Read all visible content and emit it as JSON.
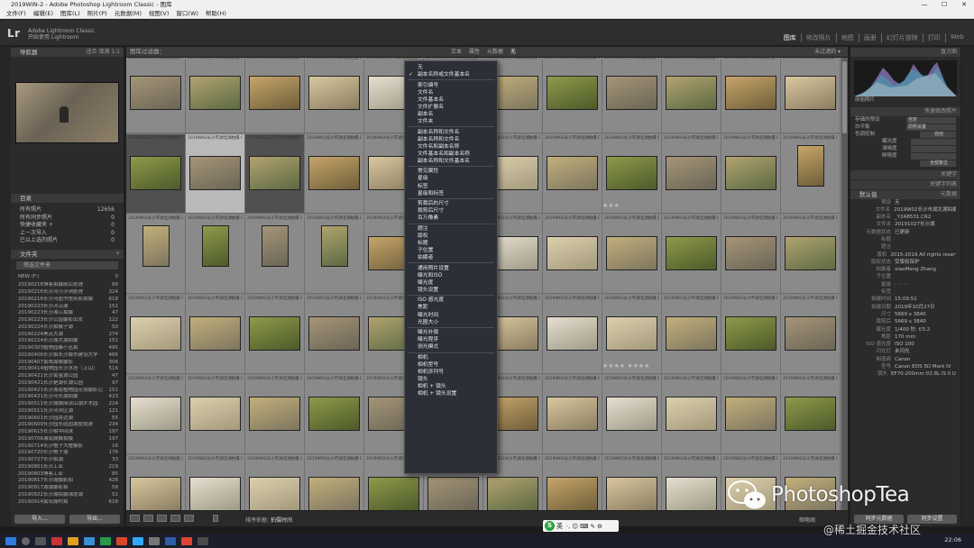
{
  "window": {
    "title": "2019WIN-2 - Adobe Photoshop Lightroom Classic - 图库",
    "controls": [
      "—",
      "☐",
      "✕"
    ]
  },
  "menubar": [
    "文件(F)",
    "编辑(E)",
    "图库(L)",
    "照片(P)",
    "元数据(M)",
    "视图(V)",
    "窗口(W)",
    "帮助(H)"
  ],
  "app": {
    "logo": "Lr",
    "identity_line1": "Adobe Lightroom Classic",
    "identity_line2": "开始使用 Lightroom",
    "modules": [
      "图库",
      "修改照片",
      "地图",
      "画册",
      "幻灯片放映",
      "打印",
      "Web"
    ],
    "active_module": "图库"
  },
  "left_panel": {
    "navigator_header": "导航器",
    "navigator_zoom": "适合  填满  1:1",
    "catalog_header": "目录",
    "catalog_items": [
      {
        "label": "所有照片",
        "count": "12656"
      },
      {
        "label": "所有同步照片",
        "count": "0"
      },
      {
        "label": "快捷收藏夹 +",
        "count": "0"
      },
      {
        "label": "上一次导入",
        "count": "0"
      },
      {
        "label": "已以上选的照片",
        "count": "0"
      }
    ],
    "folders_header": "文件夹",
    "filter_placeholder": "筛选文件夹",
    "volume": {
      "label": "NEW (F:)",
      "count": "0"
    },
    "folders": [
      {
        "label": "20190216博客拍摄前后处理",
        "count": "66"
      },
      {
        "label": "20190216长沙河小沙洲处理",
        "count": "324"
      },
      {
        "label": "20190216长沙河图书馆剪影拍摄",
        "count": "618"
      },
      {
        "label": "20190223长沙河沿湖",
        "count": "152"
      },
      {
        "label": "20190223长沙湘江拍摄",
        "count": "47"
      },
      {
        "label": "20190223长沙公园摄影出发",
        "count": "122"
      },
      {
        "label": "20190224长沙拍摄子湖",
        "count": "50"
      },
      {
        "label": "20190224黑苏大湖",
        "count": "274"
      },
      {
        "label": "20190224长沙湖大湖拍摄",
        "count": "151"
      },
      {
        "label": "20190303植物园暴小丛拍",
        "count": "495"
      },
      {
        "label": "20190406长沙拍长沙城市建设大学",
        "count": "466"
      },
      {
        "label": "20190407黄莺湖城摄影",
        "count": "306"
      },
      {
        "label": "20190414植物园长沙水塔（上山）",
        "count": "516"
      },
      {
        "label": "20190421长沙黄金湖公园",
        "count": "47"
      },
      {
        "label": "20190421长沙是湖长湖公园",
        "count": "97"
      },
      {
        "label": "20190421长沙湖南植物园花镜摄影记",
        "count": "151"
      },
      {
        "label": "20190421长沙河长湖拍摄",
        "count": "423"
      },
      {
        "label": "20190511长沙城城阅读山湖木木园",
        "count": "224"
      },
      {
        "label": "20190511长沙河滨区湖",
        "count": "121"
      },
      {
        "label": "20190601长沙园旁边湖",
        "count": "55"
      },
      {
        "label": "20190609长沙园长庭园湖度假游",
        "count": "234"
      },
      {
        "label": "20190615长沙拍中间球",
        "count": "197"
      },
      {
        "label": "20190706湘南鼓舞拍摄",
        "count": "197"
      },
      {
        "label": "20190714长沙橙子大橙摄影",
        "count": "16"
      },
      {
        "label": "20190720长沙橙子湖",
        "count": "176"
      },
      {
        "label": "20190727长沙拍湖",
        "count": "33"
      },
      {
        "label": "20190801长沙工业",
        "count": "219"
      },
      {
        "label": "20190803博客工业",
        "count": "85"
      },
      {
        "label": "20190817长沙湖摄影拍",
        "count": "428"
      },
      {
        "label": "20190817湖湖摄影拍",
        "count": "58"
      },
      {
        "label": "20190822长沙湖拍摄球度湖",
        "count": "51"
      },
      {
        "label": "20190914黄阳湖村拍",
        "count": "618"
      }
    ],
    "import_button": "导入...",
    "export_button": "导出..."
  },
  "filter_bar": {
    "title": "图库过滤器：",
    "options": [
      "文本",
      "属性",
      "元数据",
      "无"
    ],
    "right": "未过滤的 ▾"
  },
  "grid": {
    "cell_info": "2019W02长沙市湖北湖拍摄 CR2",
    "row_stars": [
      "",
      "★★★",
      "",
      "★★★★  ★★★★",
      "",
      "",
      ""
    ]
  },
  "context_menu": {
    "items": [
      {
        "label": "无",
        "checked": false,
        "sep_before": false
      },
      {
        "label": "副本名称或文件基本名",
        "checked": true,
        "sep_before": false
      },
      {
        "label": "索引编号",
        "checked": false,
        "sep_before": true
      },
      {
        "label": "文件名",
        "checked": false,
        "sep_before": false
      },
      {
        "label": "文件基本名",
        "checked": false,
        "sep_before": false
      },
      {
        "label": "文件扩展名",
        "checked": false,
        "sep_before": false
      },
      {
        "label": "副本名",
        "checked": false,
        "sep_before": false
      },
      {
        "label": "文件夹",
        "checked": false,
        "sep_before": false
      },
      {
        "label": "副本名称和文件名",
        "checked": false,
        "sep_before": true
      },
      {
        "label": "副本名称和文件名",
        "checked": false,
        "sep_before": false
      },
      {
        "label": "文件名和副本名称",
        "checked": false,
        "sep_before": false
      },
      {
        "label": "文件基本名和副本名称",
        "checked": false,
        "sep_before": false
      },
      {
        "label": "副本名称和文件基本名",
        "checked": false,
        "sep_before": false
      },
      {
        "label": "常见属性",
        "checked": false,
        "sep_before": true
      },
      {
        "label": "星级",
        "checked": false,
        "sep_before": false
      },
      {
        "label": "标签",
        "checked": false,
        "sep_before": false
      },
      {
        "label": "星级和标签",
        "checked": false,
        "sep_before": false
      },
      {
        "label": "剪裁后的尺寸",
        "checked": false,
        "sep_before": true
      },
      {
        "label": "裁剪后尺寸",
        "checked": false,
        "sep_before": false
      },
      {
        "label": "百万像素",
        "checked": false,
        "sep_before": false
      },
      {
        "label": "题注",
        "checked": false,
        "sep_before": true
      },
      {
        "label": "版权",
        "checked": false,
        "sep_before": false
      },
      {
        "label": "标题",
        "checked": false,
        "sep_before": false
      },
      {
        "label": "子位置",
        "checked": false,
        "sep_before": false
      },
      {
        "label": "拍摄者",
        "checked": false,
        "sep_before": false
      },
      {
        "label": "通用照片设置",
        "checked": false,
        "sep_before": true
      },
      {
        "label": "曝光和ISO",
        "checked": false,
        "sep_before": false
      },
      {
        "label": "曝光度",
        "checked": false,
        "sep_before": false
      },
      {
        "label": "镜头设置",
        "checked": false,
        "sep_before": false
      },
      {
        "label": "ISO 感光度",
        "checked": false,
        "sep_before": true
      },
      {
        "label": "焦距",
        "checked": false,
        "sep_before": false
      },
      {
        "label": "曝光时间",
        "checked": false,
        "sep_before": false
      },
      {
        "label": "光圈大小",
        "checked": false,
        "sep_before": false
      },
      {
        "label": "曝光补偿",
        "checked": false,
        "sep_before": true
      },
      {
        "label": "曝光程序",
        "checked": false,
        "sep_before": false
      },
      {
        "label": "测光模式",
        "checked": false,
        "sep_before": false
      },
      {
        "label": "相机",
        "checked": false,
        "sep_before": true
      },
      {
        "label": "相机型号",
        "checked": false,
        "sep_before": false
      },
      {
        "label": "相机序列号",
        "checked": false,
        "sep_before": false
      },
      {
        "label": "镜头",
        "checked": false,
        "sep_before": false
      },
      {
        "label": "相机 + 镜头",
        "checked": false,
        "sep_before": false
      },
      {
        "label": "相机 + 镜头设置",
        "checked": false,
        "sep_before": false
      }
    ]
  },
  "toolbar": {
    "sort_label": "排序依据：",
    "sort_value": "拍摄时间",
    "right_label": "缩略图"
  },
  "right_panel": {
    "histogram_header": "直方图",
    "histogram_info": "原始照片",
    "quick_develop_header": "快速修改照片",
    "saved_preset_label": "存储的预设",
    "saved_preset_value": "自定",
    "white_balance_label": "白平衡",
    "white_balance_value": "原照设置",
    "tone_control_label": "色调控制",
    "tone_control_button": "自动",
    "adjust_labels": [
      "曝光度",
      "清晰度",
      "鲜艳度"
    ],
    "reset_button": "全部复位",
    "keywording_header": "关键字",
    "keyword_list_header": "关键字列表",
    "metadata_header": "元数据",
    "metadata_preset": "默认值",
    "metadata": [
      {
        "k": "预设",
        "v": "无"
      },
      {
        "k": "文件名",
        "v": "2019W02长沙市湖北湖拍摄"
      },
      {
        "k": "副本名",
        "v": "_Y2A8531.CR2"
      },
      {
        "k": "文件夹",
        "v": "20191027长沙湖"
      },
      {
        "k": "元数据状态",
        "v": "已更新"
      },
      {
        "k": "标题",
        "v": ""
      },
      {
        "k": "题注",
        "v": ""
      },
      {
        "k": "版权",
        "v": "2015-2019 All rights reserved"
      },
      {
        "k": "版权状态",
        "v": "受版权保护"
      },
      {
        "k": "拍摄者",
        "v": "xiaoMeng Zhang"
      },
      {
        "k": "子位置",
        "v": ""
      },
      {
        "k": "星级",
        "v": "·  ·  ·  ·  ·"
      },
      {
        "k": "标签",
        "v": ""
      },
      {
        "k": "拍摄时间",
        "v": "15:09:51"
      },
      {
        "k": "拍摄日期",
        "v": "2019年10月27日"
      },
      {
        "k": "尺寸",
        "v": "5669 x 3840"
      },
      {
        "k": "裁剪后",
        "v": "5669 x 3840"
      },
      {
        "k": "曝光度",
        "v": "1/400 秒, f/3.2"
      },
      {
        "k": "焦距",
        "v": "170 mm"
      },
      {
        "k": "ISO 感光度",
        "v": "ISO 100"
      },
      {
        "k": "闪光灯",
        "v": "未闪光"
      },
      {
        "k": "制造商",
        "v": "Canon"
      },
      {
        "k": "型号",
        "v": "Canon EOS 5D Mark IV"
      },
      {
        "k": "镜头",
        "v": "EF70-200mm f/2.8L IS II USM"
      }
    ],
    "sync_metadata_button": "同步元数据",
    "sync_settings_button": "同步设置"
  },
  "ime_hint": {
    "label": "英",
    "extra": "·, ☺ ⌨ ✎ ⚙"
  },
  "taskbar": {
    "clock": "22:06"
  },
  "watermark": {
    "brand": "PhotoshopTea",
    "site": "@稀土掘金技术社区"
  }
}
